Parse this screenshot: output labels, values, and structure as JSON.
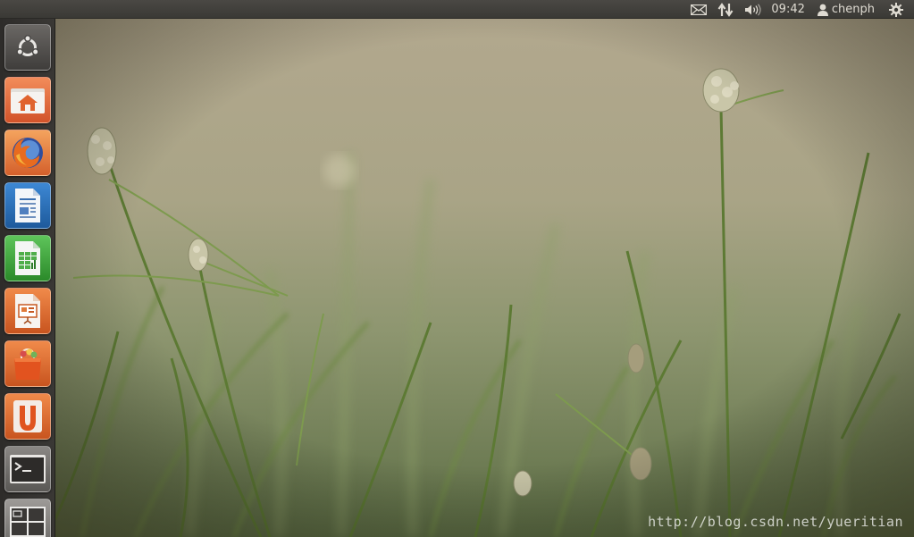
{
  "panel": {
    "clock": "09:42",
    "username": "chenph",
    "indicators": [
      {
        "icon": "envelope-icon"
      },
      {
        "icon": "network-arrows-icon"
      },
      {
        "icon": "speaker-volume-icon"
      },
      {
        "icon": "user-icon"
      },
      {
        "icon": "session-gear-icon"
      }
    ]
  },
  "launcher": {
    "items": [
      {
        "name": "dash-home-button",
        "icon": "ubuntu-logo-icon"
      },
      {
        "name": "home-folder-launcher",
        "icon": "home-folder-icon"
      },
      {
        "name": "firefox-launcher",
        "icon": "firefox-icon"
      },
      {
        "name": "libreoffice-writer-launcher",
        "icon": "writer-document-icon"
      },
      {
        "name": "libreoffice-calc-launcher",
        "icon": "calc-spreadsheet-icon"
      },
      {
        "name": "libreoffice-impress-launcher",
        "icon": "impress-presentation-icon"
      },
      {
        "name": "software-center-launcher",
        "icon": "shopping-bag-icon"
      },
      {
        "name": "ubuntu-one-launcher",
        "icon": "ubuntu-one-icon"
      },
      {
        "name": "terminal-launcher",
        "icon": "terminal-icon"
      },
      {
        "name": "workspace-switcher-launcher",
        "icon": "workspaces-icon"
      }
    ]
  },
  "desktop": {
    "watermark": "http://blog.csdn.net/yueritian"
  },
  "colors": {
    "panel_bg": "#3c3b37",
    "launcher_bg": "#33312e",
    "ubuntu_orange": "#dd4814"
  }
}
